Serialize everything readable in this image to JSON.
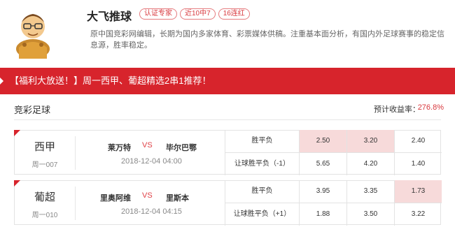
{
  "expert": {
    "name": "大飞推球",
    "tags": [
      "认证专家",
      "近10中7",
      "16连红"
    ],
    "bio": "原中国竞彩网编辑，长期为国内多家体育、彩票媒体供稿。注重基本面分析，有国内外足球赛事的稳定信息源，胜率稳定。"
  },
  "banner": "【福利大放送！】周一西甲、葡超精选2串1推荐！",
  "section": {
    "title": "竞彩足球",
    "return_label": "预计收益率：",
    "return_value": "276.8%"
  },
  "matches": [
    {
      "league": "西甲",
      "no": "周一007",
      "home": "莱万特",
      "vs": "VS",
      "away": "毕尔巴鄂",
      "time": "2018-12-04 04:00",
      "rows": [
        {
          "label": "胜平负",
          "odds": [
            "2.50",
            "3.20",
            "2.40"
          ],
          "selected": [
            true,
            true,
            false
          ]
        },
        {
          "label": "让球胜平负（-1）",
          "odds": [
            "5.65",
            "4.20",
            "1.40"
          ],
          "selected": [
            false,
            false,
            false
          ]
        }
      ]
    },
    {
      "league": "葡超",
      "no": "周一010",
      "home": "里奥阿维",
      "vs": "VS",
      "away": "里斯本",
      "time": "2018-12-04 04:15",
      "rows": [
        {
          "label": "胜平负",
          "odds": [
            "3.95",
            "3.35",
            "1.73"
          ],
          "selected": [
            false,
            false,
            true
          ]
        },
        {
          "label": "让球胜平负（+1）",
          "odds": [
            "1.88",
            "3.50",
            "3.22"
          ],
          "selected": [
            false,
            false,
            false
          ]
        }
      ]
    }
  ],
  "colors": {
    "accent": "#d7242c",
    "selected_bg": "#f7dada"
  }
}
